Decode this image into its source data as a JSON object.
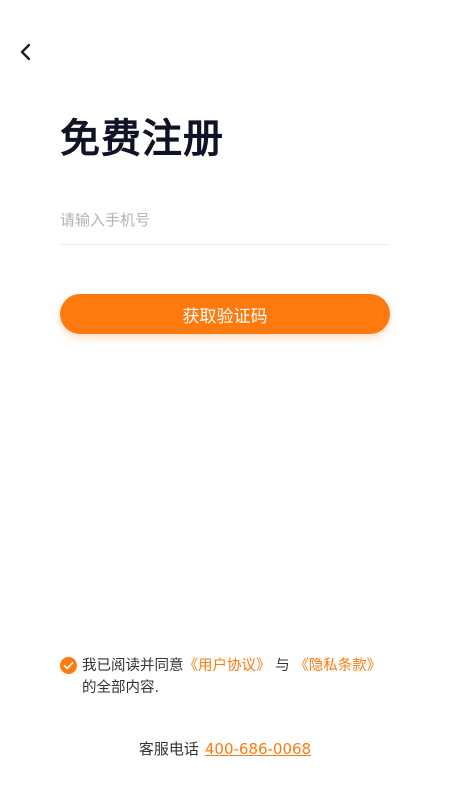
{
  "header": {
    "back_icon": "chevron-left-icon"
  },
  "main": {
    "title": "免费注册",
    "phone_placeholder": "请输入手机号",
    "phone_value": "",
    "get_code_label": "获取验证码"
  },
  "agreement": {
    "checked": true,
    "check_icon": "check-circle-icon",
    "prefix": "我已阅读并同意",
    "user_agreement": "《用户协议》",
    "conjunction": "与",
    "privacy_policy": "《隐私条款》",
    "suffix": "的全部内容."
  },
  "service": {
    "label": "客服电话",
    "phone": "400-686-0068"
  },
  "colors": {
    "accent": "#fe7a0e",
    "title": "#101225"
  }
}
